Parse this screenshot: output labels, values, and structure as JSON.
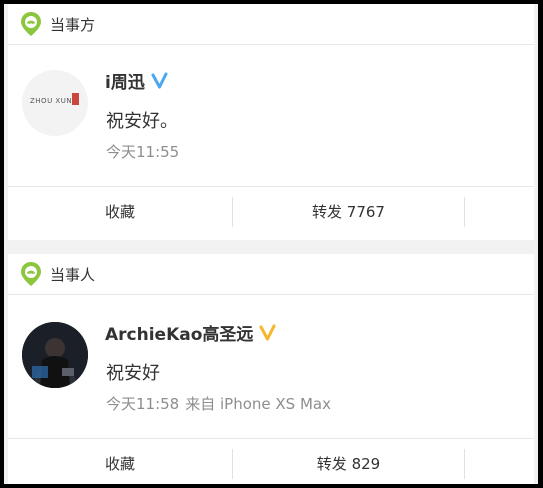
{
  "cards": [
    {
      "label": "当事方",
      "user_name": "i周迅",
      "verify_color": "#4aa7f1",
      "avatar_logo_text": "ZHOU XUN",
      "text": "祝安好。",
      "time": "今天11:55",
      "source": "",
      "actions": {
        "favorite": "收藏",
        "forward": "转发 7767"
      }
    },
    {
      "label": "当事人",
      "user_name": "ArchieKao高圣远",
      "verify_color": "#f7b52b",
      "text": "祝安好",
      "time": "今天11:58",
      "source": "来自 iPhone XS Max",
      "actions": {
        "favorite": "收藏",
        "forward": "转发 829"
      }
    }
  ],
  "colors": {
    "pin_green": "#8cc63f",
    "page_bg": "#f2f2f2"
  }
}
